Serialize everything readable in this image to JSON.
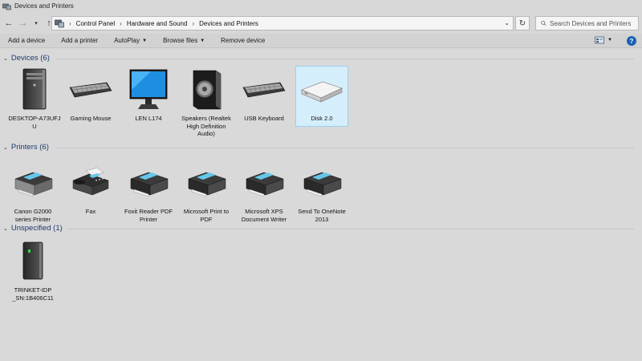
{
  "window": {
    "title": "Devices and Printers"
  },
  "address": {
    "crumbs": [
      "Control Panel",
      "Hardware and Sound",
      "Devices and Printers"
    ],
    "search_placeholder": "Search Devices and Printers"
  },
  "commands": {
    "add_device": "Add a device",
    "add_printer": "Add a printer",
    "autoplay": "AutoPlay",
    "browse_files": "Browse files",
    "remove_device": "Remove device"
  },
  "groups": {
    "devices": {
      "title": "Devices (6)",
      "items": [
        {
          "label": "DESKTOP-A73UFJ U",
          "icon": "desktop-tower-icon"
        },
        {
          "label": "Gaming Mouse",
          "icon": "keyboard-icon"
        },
        {
          "label": "LEN L174",
          "icon": "monitor-icon"
        },
        {
          "label": "Speakers (Realtek High Definition Audio)",
          "icon": "speaker-icon"
        },
        {
          "label": "USB Keyboard",
          "icon": "keyboard-icon"
        },
        {
          "label": "Disk 2.0",
          "icon": "external-drive-icon",
          "selected": true
        }
      ]
    },
    "printers": {
      "title": "Printers (6)",
      "items": [
        {
          "label": "Canon G2000 series Printer",
          "icon": "printer-icon"
        },
        {
          "label": "Fax",
          "icon": "fax-icon"
        },
        {
          "label": "Foxit Reader PDF Printer",
          "icon": "printer-icon"
        },
        {
          "label": "Microsoft Print to PDF",
          "icon": "printer-icon"
        },
        {
          "label": "Microsoft XPS Document Writer",
          "icon": "printer-icon"
        },
        {
          "label": "Send To OneNote 2013",
          "icon": "printer-icon"
        }
      ]
    },
    "unspecified": {
      "title": "Unspecified (1)",
      "items": [
        {
          "label": "TRINKET-IDP _SN:1B406C11",
          "icon": "network-box-icon"
        }
      ]
    }
  },
  "colors": {
    "group_title": "#1e3a6e",
    "selection": "#d5eefb",
    "help": "#1a5fb4"
  }
}
